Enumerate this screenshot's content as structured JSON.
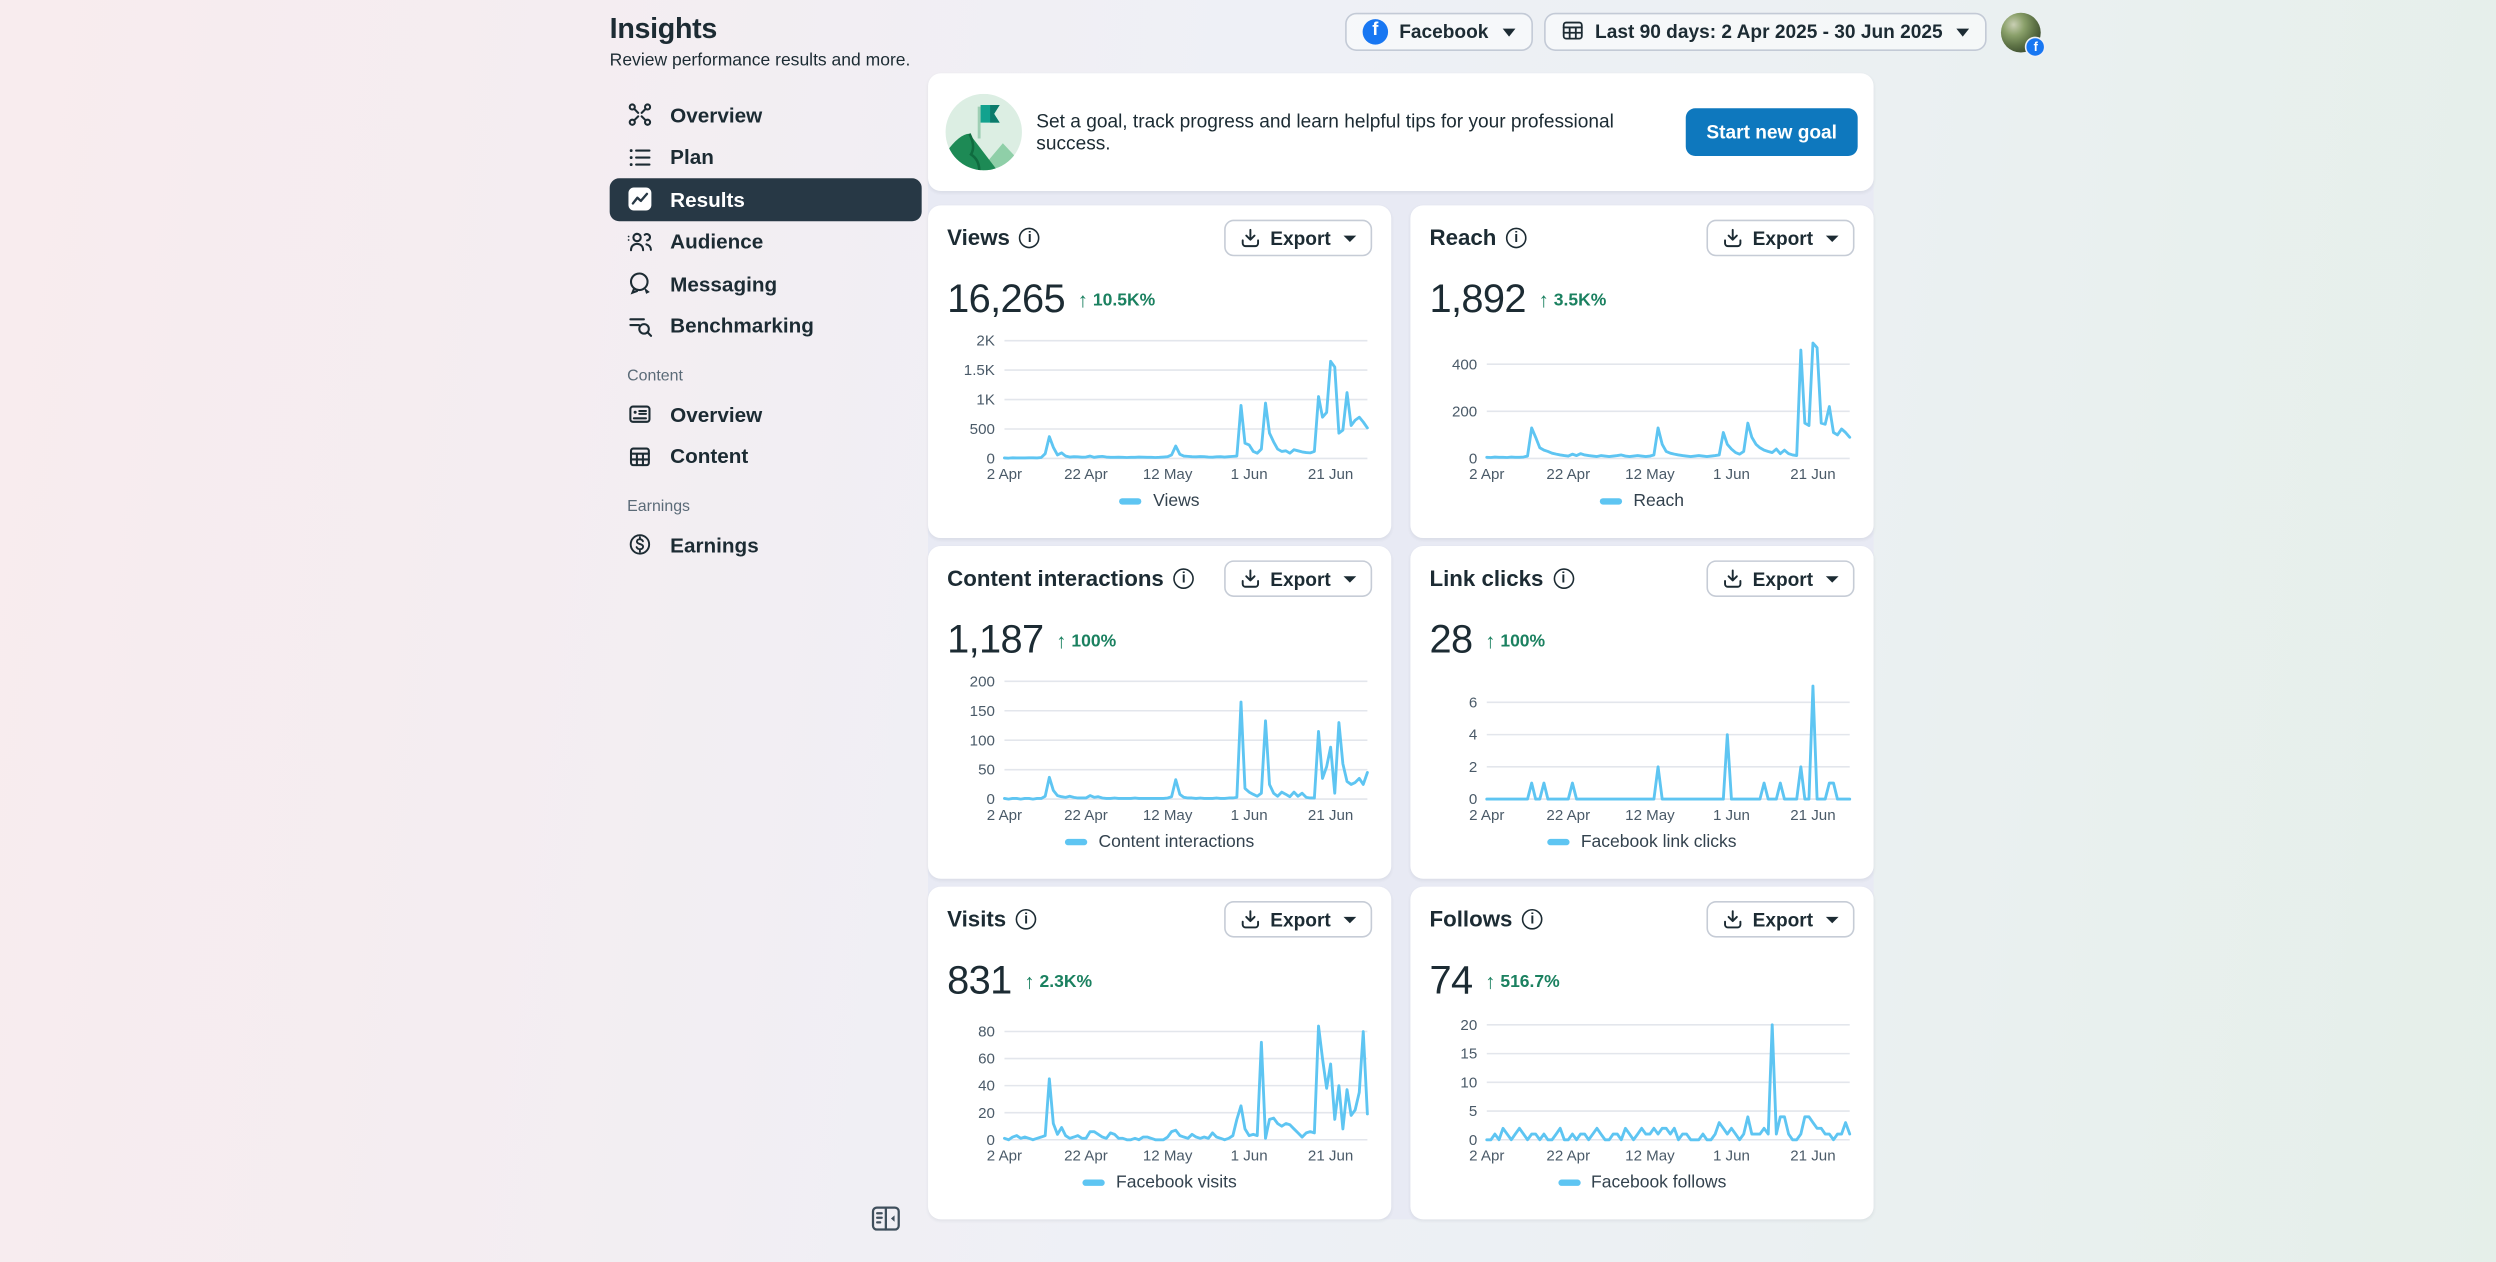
{
  "page": {
    "title": "Insights",
    "subtitle": "Review performance results and more."
  },
  "sidebar": {
    "main_items": [
      {
        "id": "overview",
        "label": "Overview",
        "icon": "overview-icon",
        "selected": false
      },
      {
        "id": "plan",
        "label": "Plan",
        "icon": "plan-icon",
        "selected": false
      },
      {
        "id": "results",
        "label": "Results",
        "icon": "results-icon",
        "selected": true
      },
      {
        "id": "audience",
        "label": "Audience",
        "icon": "audience-icon",
        "selected": false
      },
      {
        "id": "messaging",
        "label": "Messaging",
        "icon": "messaging-icon",
        "selected": false
      },
      {
        "id": "benchmarking",
        "label": "Benchmarking",
        "icon": "benchmarking-icon",
        "selected": false
      }
    ],
    "sections": [
      {
        "label": "Content",
        "items": [
          {
            "id": "content-overview",
            "label": "Overview",
            "icon": "card-icon"
          },
          {
            "id": "content",
            "label": "Content",
            "icon": "table-icon"
          }
        ]
      },
      {
        "label": "Earnings",
        "items": [
          {
            "id": "earnings",
            "label": "Earnings",
            "icon": "dollar-icon"
          }
        ]
      }
    ]
  },
  "header": {
    "platform": {
      "label": "Facebook",
      "icon": "facebook-logo-icon"
    },
    "date_range": {
      "label": "Last 90 days: 2 Apr 2025 - 30 Jun 2025",
      "icon": "calendar-grid-icon"
    },
    "avatar_badge": "f"
  },
  "goal_banner": {
    "message": "Set a goal, track progress and learn helpful tips for your professional success.",
    "button_label": "Start new goal"
  },
  "export_label": "Export",
  "colors": {
    "facebook_blue": "#1877f2",
    "primary_button_blue": "#0e78be",
    "positive_green": "#1b8160",
    "chart_line_blue": "#5ec5f2",
    "selected_nav_bg": "#273845"
  },
  "chart_data": [
    {
      "id": "views",
      "type": "line",
      "metric": "Views",
      "value": "16,265",
      "delta": "10.5K%",
      "delta_direction": "up",
      "legend": "Views",
      "line_color": "#5ec5f2",
      "x_domain": [
        0,
        89
      ],
      "x_tick_days": [
        0,
        20,
        40,
        60,
        80
      ],
      "x_tick_labels": [
        "2 Apr",
        "22 Apr",
        "12 May",
        "1 Jun",
        "21 Jun"
      ],
      "y_max": 2000,
      "y_ticks": [
        {
          "v": 0,
          "label": "0"
        },
        {
          "v": 500,
          "label": "500"
        },
        {
          "v": 1000,
          "label": "1K"
        },
        {
          "v": 1500,
          "label": "1.5K"
        },
        {
          "v": 2000,
          "label": "2K"
        }
      ],
      "values": [
        8,
        6,
        10,
        7,
        9,
        8,
        12,
        10,
        9,
        15,
        80,
        370,
        190,
        60,
        95,
        40,
        25,
        30,
        28,
        22,
        25,
        40,
        20,
        30,
        35,
        25,
        20,
        18,
        22,
        20,
        15,
        18,
        20,
        25,
        22,
        20,
        18,
        15,
        20,
        25,
        30,
        60,
        210,
        70,
        40,
        35,
        30,
        28,
        32,
        30,
        25,
        22,
        28,
        30,
        25,
        30,
        35,
        40,
        900,
        260,
        230,
        120,
        90,
        160,
        940,
        430,
        280,
        160,
        120,
        130,
        90,
        150,
        130,
        110,
        100,
        95,
        120,
        1050,
        700,
        780,
        1650,
        1550,
        430,
        480,
        1120,
        560,
        650,
        700,
        620,
        520
      ]
    },
    {
      "id": "reach",
      "type": "line",
      "metric": "Reach",
      "value": "1,892",
      "delta": "3.5K%",
      "delta_direction": "up",
      "legend": "Reach",
      "line_color": "#5ec5f2",
      "x_domain": [
        0,
        89
      ],
      "x_tick_days": [
        0,
        20,
        40,
        60,
        80
      ],
      "x_tick_labels": [
        "2 Apr",
        "22 Apr",
        "12 May",
        "1 Jun",
        "21 Jun"
      ],
      "y_max": 500,
      "y_ticks": [
        {
          "v": 0,
          "label": "0"
        },
        {
          "v": 200,
          "label": "200"
        },
        {
          "v": 400,
          "label": "400"
        }
      ],
      "values": [
        5,
        4,
        6,
        5,
        5,
        4,
        6,
        5,
        5,
        6,
        10,
        130,
        90,
        45,
        35,
        30,
        22,
        18,
        15,
        12,
        10,
        18,
        12,
        20,
        15,
        12,
        10,
        8,
        12,
        10,
        8,
        10,
        12,
        15,
        10,
        8,
        10,
        12,
        10,
        8,
        10,
        15,
        130,
        60,
        30,
        22,
        18,
        15,
        12,
        10,
        8,
        10,
        12,
        10,
        8,
        10,
        12,
        15,
        110,
        60,
        40,
        25,
        18,
        30,
        150,
        90,
        60,
        45,
        35,
        30,
        25,
        40,
        20,
        35,
        20,
        15,
        12,
        460,
        150,
        140,
        490,
        470,
        150,
        145,
        220,
        110,
        100,
        125,
        110,
        90
      ]
    },
    {
      "id": "content-interactions",
      "type": "line",
      "metric": "Content interactions",
      "value": "1,187",
      "delta": "100%",
      "delta_direction": "up",
      "legend": "Content interactions",
      "line_color": "#5ec5f2",
      "x_domain": [
        0,
        89
      ],
      "x_tick_days": [
        0,
        20,
        40,
        60,
        80
      ],
      "x_tick_labels": [
        "2 Apr",
        "22 Apr",
        "12 May",
        "1 Jun",
        "21 Jun"
      ],
      "y_max": 200,
      "y_ticks": [
        {
          "v": 0,
          "label": "0"
        },
        {
          "v": 50,
          "label": "50"
        },
        {
          "v": 100,
          "label": "100"
        },
        {
          "v": 150,
          "label": "150"
        },
        {
          "v": 200,
          "label": "200"
        }
      ],
      "values": [
        1,
        0,
        1,
        1,
        0,
        1,
        1,
        0,
        1,
        1,
        5,
        37,
        15,
        6,
        4,
        3,
        5,
        3,
        2,
        2,
        2,
        6,
        3,
        4,
        2,
        1,
        1,
        2,
        1,
        1,
        1,
        1,
        2,
        1,
        1,
        1,
        1,
        1,
        1,
        1,
        2,
        4,
        33,
        8,
        3,
        2,
        2,
        1,
        2,
        1,
        1,
        1,
        2,
        1,
        1,
        2,
        2,
        3,
        165,
        18,
        12,
        8,
        5,
        10,
        133,
        25,
        10,
        5,
        12,
        8,
        4,
        12,
        5,
        10,
        3,
        2,
        2,
        115,
        35,
        55,
        88,
        10,
        130,
        60,
        30,
        25,
        28,
        35,
        25,
        45
      ]
    },
    {
      "id": "link-clicks",
      "type": "line",
      "metric": "Link clicks",
      "value": "28",
      "delta": "100%",
      "delta_direction": "up",
      "legend": "Facebook link clicks",
      "line_color": "#5ec5f2",
      "x_domain": [
        0,
        89
      ],
      "x_tick_days": [
        0,
        20,
        40,
        60,
        80
      ],
      "x_tick_labels": [
        "2 Apr",
        "22 Apr",
        "12 May",
        "1 Jun",
        "21 Jun"
      ],
      "y_max": 7.3,
      "y_ticks": [
        {
          "v": 0,
          "label": "0"
        },
        {
          "v": 2,
          "label": "2"
        },
        {
          "v": 4,
          "label": "4"
        },
        {
          "v": 6,
          "label": "6"
        }
      ],
      "values": [
        0,
        0,
        0,
        0,
        0,
        0,
        0,
        0,
        0,
        0,
        0,
        1,
        0,
        0,
        1,
        0,
        0,
        0,
        0,
        0,
        0,
        1,
        0,
        0,
        0,
        0,
        0,
        0,
        0,
        0,
        0,
        0,
        0,
        0,
        0,
        0,
        0,
        0,
        0,
        0,
        0,
        0,
        2,
        0,
        0,
        0,
        0,
        0,
        0,
        0,
        0,
        0,
        0,
        0,
        0,
        0,
        0,
        0,
        0,
        4,
        0,
        0,
        0,
        0,
        0,
        0,
        0,
        0,
        1,
        0,
        0,
        0,
        1,
        0,
        0,
        0,
        0,
        2,
        0,
        0,
        7,
        0,
        0,
        0,
        1,
        1,
        0,
        0,
        0,
        0
      ]
    },
    {
      "id": "visits",
      "type": "line",
      "metric": "Visits",
      "value": "831",
      "delta": "2.3K%",
      "delta_direction": "up",
      "legend": "Facebook visits",
      "line_color": "#5ec5f2",
      "x_domain": [
        0,
        89
      ],
      "x_tick_days": [
        0,
        20,
        40,
        60,
        80
      ],
      "x_tick_labels": [
        "2 Apr",
        "22 Apr",
        "12 May",
        "1 Jun",
        "21 Jun"
      ],
      "y_max": 87,
      "y_ticks": [
        {
          "v": 0,
          "label": "0"
        },
        {
          "v": 20,
          "label": "20"
        },
        {
          "v": 40,
          "label": "40"
        },
        {
          "v": 60,
          "label": "60"
        },
        {
          "v": 80,
          "label": "80"
        }
      ],
      "values": [
        1,
        0,
        2,
        3,
        1,
        2,
        1,
        0,
        1,
        2,
        3,
        45,
        12,
        4,
        9,
        3,
        1,
        2,
        3,
        1,
        1,
        6,
        6,
        4,
        2,
        1,
        5,
        4,
        1,
        1,
        0,
        0,
        1,
        0,
        2,
        2,
        1,
        0,
        0,
        0,
        2,
        6,
        7,
        3,
        2,
        1,
        4,
        2,
        1,
        2,
        1,
        5,
        2,
        1,
        0,
        1,
        3,
        15,
        25,
        8,
        3,
        4,
        3,
        72,
        1,
        15,
        16,
        12,
        10,
        12,
        11,
        8,
        5,
        2,
        5,
        6,
        5,
        84,
        60,
        38,
        56,
        15,
        40,
        8,
        37,
        18,
        22,
        35,
        80,
        19
      ]
    },
    {
      "id": "follows",
      "type": "line",
      "metric": "Follows",
      "value": "74",
      "delta": "516.7%",
      "delta_direction": "up",
      "legend": "Facebook follows",
      "line_color": "#5ec5f2",
      "x_domain": [
        0,
        89
      ],
      "x_tick_days": [
        0,
        20,
        40,
        60,
        80
      ],
      "x_tick_labels": [
        "2 Apr",
        "22 Apr",
        "12 May",
        "1 Jun",
        "21 Jun"
      ],
      "y_max": 20.5,
      "y_ticks": [
        {
          "v": 0,
          "label": "0"
        },
        {
          "v": 5,
          "label": "5"
        },
        {
          "v": 10,
          "label": "10"
        },
        {
          "v": 15,
          "label": "15"
        },
        {
          "v": 20,
          "label": "20"
        }
      ],
      "values": [
        0,
        0,
        1,
        0,
        2,
        1,
        0,
        1,
        2,
        1,
        0,
        1,
        1,
        0,
        1,
        0,
        0,
        1,
        2,
        0,
        0,
        1,
        0,
        1,
        1,
        0,
        1,
        2,
        1,
        0,
        0,
        1,
        1,
        0,
        2,
        1,
        0,
        1,
        2,
        1,
        1,
        2,
        1,
        2,
        2,
        1,
        2,
        0,
        1,
        1,
        0,
        0,
        0,
        1,
        0,
        0,
        1,
        3,
        2,
        1,
        2,
        1,
        0,
        1,
        4,
        1,
        1,
        1,
        2,
        1,
        20,
        1,
        4,
        4,
        1,
        0,
        0,
        1,
        4,
        4,
        3,
        2,
        2,
        1,
        1,
        0,
        1,
        1,
        3,
        1
      ]
    }
  ]
}
